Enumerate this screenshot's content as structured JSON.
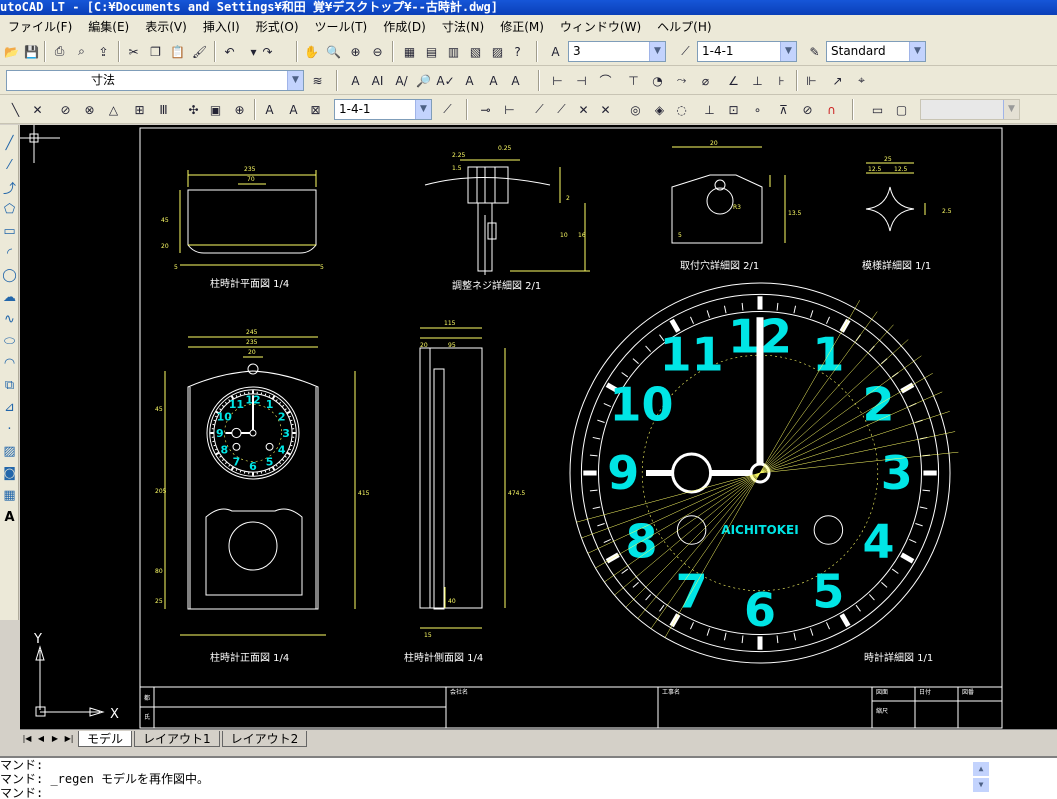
{
  "window": {
    "title": "utoCAD LT - [C:¥Documents and Settings¥和田 覚¥デスクトップ¥--古時計.dwg]"
  },
  "menu": {
    "items": [
      "ファイル(F)",
      "編集(E)",
      "表示(V)",
      "挿入(I)",
      "形式(O)",
      "ツール(T)",
      "作成(D)",
      "寸法(N)",
      "修正(M)",
      "ウィンドウ(W)",
      "ヘルプ(H)"
    ]
  },
  "toolbar1": {
    "dimstyle_value": "3",
    "linetype_value": "1-4-1",
    "textstyle_value": "Standard"
  },
  "toolbar2": {
    "layer_value": "寸法"
  },
  "toolbar3": {
    "layer_combo_value": "1-4-1"
  },
  "drawing": {
    "views": {
      "plan": "柱時計平面図  1/4",
      "screw": "調整ネジ詳細図  2/1",
      "hole": "取付穴詳細図  2/1",
      "pattern": "模様詳細図  1/1",
      "front": "柱時計正面図  1/4",
      "side": "柱時計側面図  1/4",
      "dial": "時計詳細図  1/1"
    },
    "brand": "AICHITOKEI",
    "numerals": [
      "12",
      "1",
      "2",
      "3",
      "4",
      "5",
      "6",
      "7",
      "8",
      "9",
      "10",
      "11"
    ],
    "dims": {
      "plan_width": "235",
      "plan_inner": "70",
      "plan_h1": "45",
      "plan_h2": "20",
      "plan_side": "5",
      "front_width": "245",
      "front_inner": "235",
      "front_top": "20",
      "front_h_total": "415",
      "front_h_a": "45",
      "front_h_b": "205",
      "front_h_c": "80",
      "front_h_d": "25",
      "side_width": "115",
      "side_inner": "95",
      "side_a": "20",
      "side_b": "15",
      "side_h": "474.5",
      "side_h2": "40",
      "hole_w": "20",
      "hole_h": "13.5",
      "hole_r": "R3",
      "hole_d": "5",
      "pat_w": "25",
      "pat_a": "12.5",
      "pat_h": "2.5",
      "screw_a": "2.25",
      "screw_b": "0.25",
      "screw_c": "1.5",
      "screw_d": "16",
      "screw_e": "2",
      "screw_f": "10"
    },
    "title_block": {
      "cells": [
        "都",
        "氏",
        "会社名",
        "工事名",
        "図面",
        "日付",
        "図番",
        "縮尺"
      ]
    },
    "axis": {
      "y": "Y",
      "x": "X"
    }
  },
  "layout_tabs": [
    "モデル",
    "レイアウト1",
    "レイアウト2"
  ],
  "command": {
    "lines": [
      "マンド:",
      "マンド: _regen モデルを再作図中。",
      "マンド:"
    ]
  },
  "colors": {
    "numeral": "#00e5e5",
    "dim": "#ffff66",
    "geometry": "#ffffff",
    "titlebar": "#0a3fb8"
  }
}
